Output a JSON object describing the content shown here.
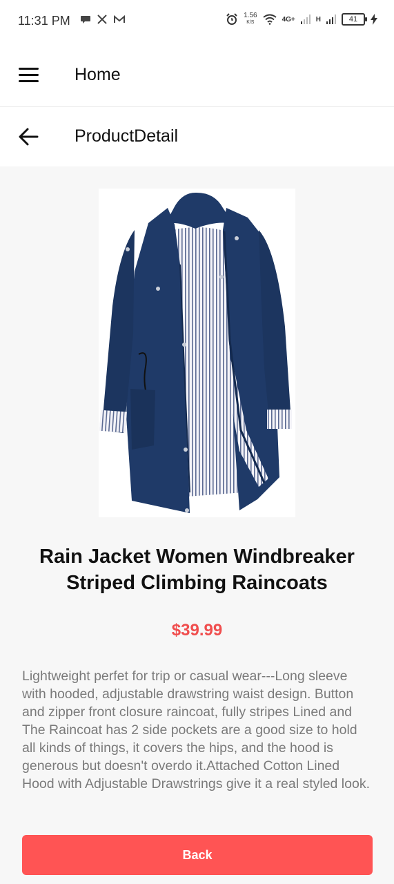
{
  "status_bar": {
    "time": "11:31 PM",
    "speed_value": "1.56",
    "speed_unit": "K/S",
    "network_label": "4G+",
    "network_label_2": "H",
    "battery_level": "41"
  },
  "header": {
    "title": "Home"
  },
  "subheader": {
    "title": "ProductDetail"
  },
  "product": {
    "title": "Rain Jacket Women Windbreaker Striped Climbing Raincoats",
    "price": "$39.99",
    "description": "Lightweight perfet for trip or casual wear---Long sleeve with hooded, adjustable drawstring waist design. Button and zipper front closure raincoat, fully stripes Lined and The Raincoat has 2 side pockets are a good size to hold all kinds of things, it covers the hips, and the hood is generous but doesn't overdo it.Attached Cotton Lined Hood with Adjustable Drawstrings give it a real styled look."
  },
  "actions": {
    "back_label": "Back"
  },
  "colors": {
    "accent": "#ff5454",
    "price": "#f04e4e",
    "jacket": "#1f3a68"
  },
  "icons": {
    "menu": "hamburger-icon",
    "back": "arrow-left-icon"
  }
}
